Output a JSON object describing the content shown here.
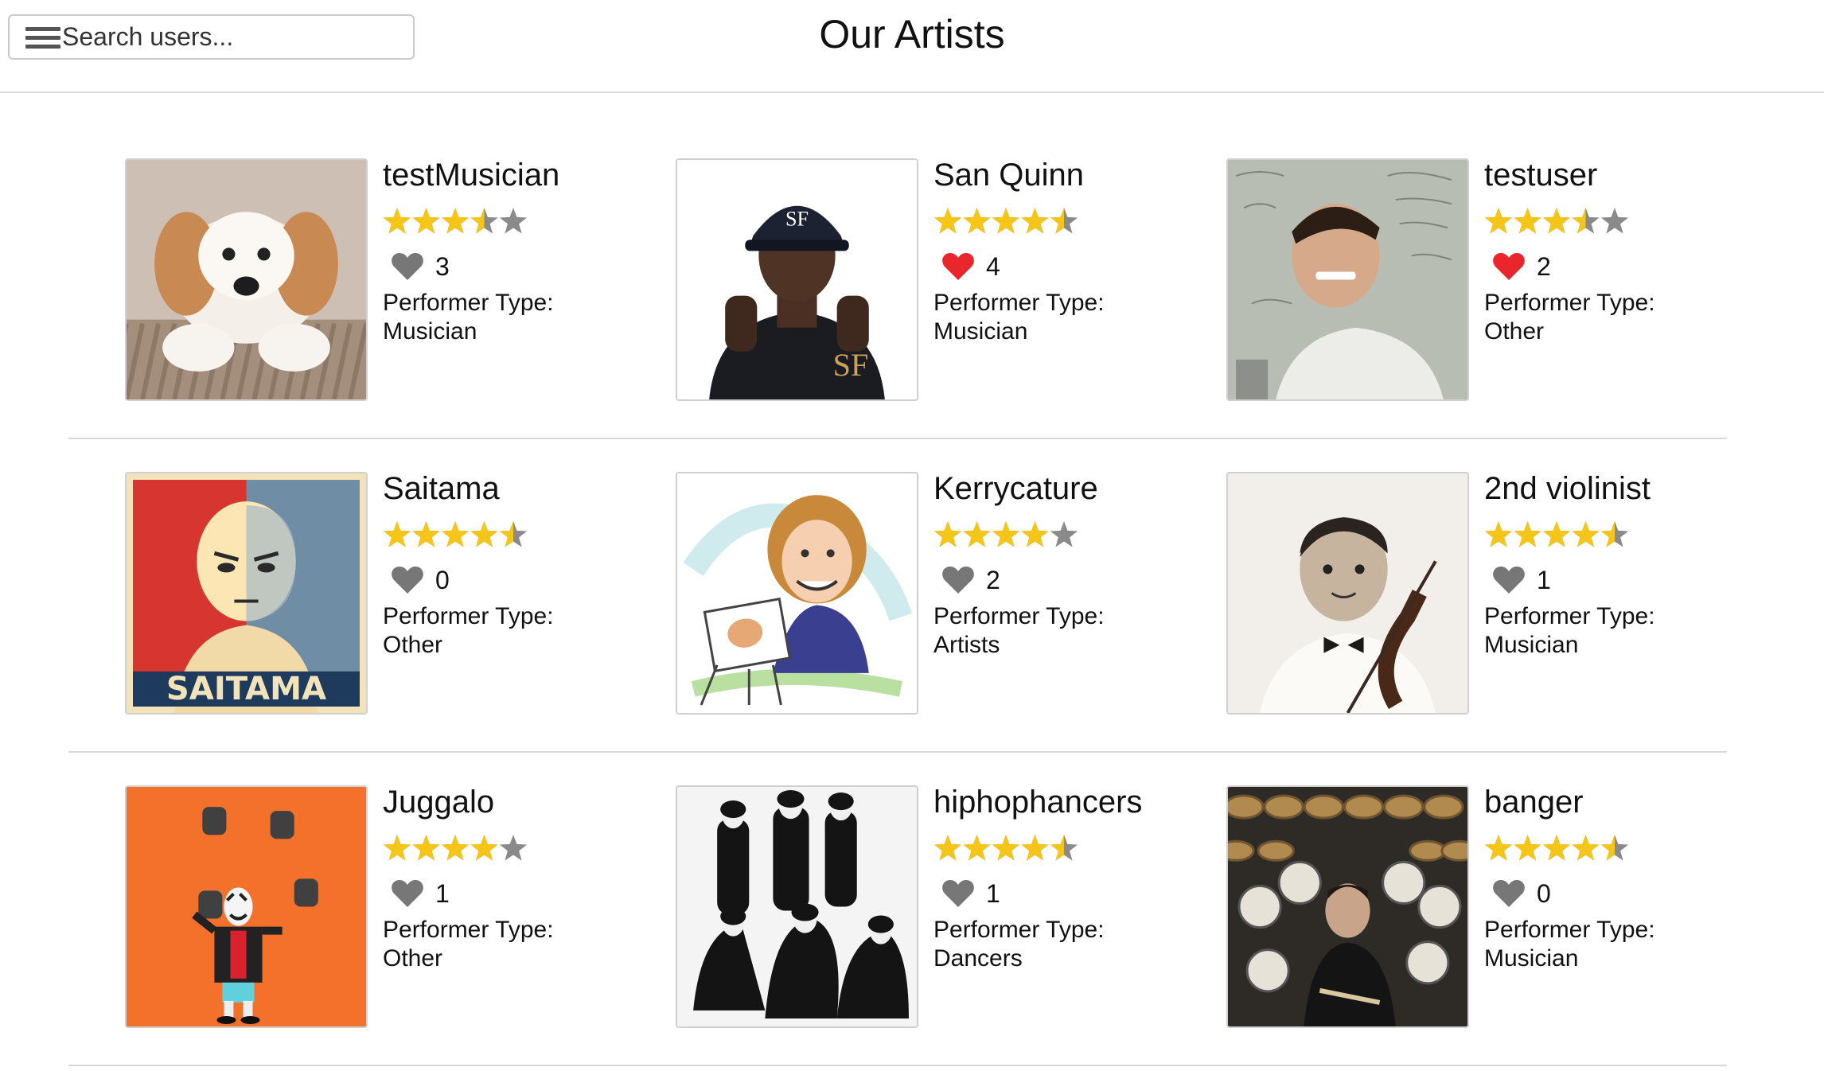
{
  "search": {
    "placeholder": "Search users..."
  },
  "page": {
    "title": "Our Artists"
  },
  "performer_type_label": "Performer Type:",
  "colors": {
    "star": "#f5c518",
    "star_empty": "#8a8a8a",
    "heart_liked": "#e8262b",
    "heart_default": "#777777"
  },
  "artists": [
    {
      "name": "testMusician",
      "rating": 3.5,
      "likes": "3",
      "liked": false,
      "performer_type": "Musician",
      "image": "puppy-photo"
    },
    {
      "name": "San Quinn",
      "rating": 4.5,
      "likes": "4",
      "liked": true,
      "performer_type": "Musician",
      "image": "rapper-photo"
    },
    {
      "name": "testuser",
      "rating": 3.5,
      "likes": "2",
      "liked": true,
      "performer_type": "Other",
      "image": "man-whiteboard-photo"
    },
    {
      "name": "Saitama",
      "rating": 4.5,
      "likes": "0",
      "liked": false,
      "performer_type": "Other",
      "image": "saitama-poster"
    },
    {
      "name": "Kerrycature",
      "rating": 4,
      "likes": "2",
      "liked": false,
      "performer_type": "Artists",
      "image": "caricature-drawing"
    },
    {
      "name": "2nd violinist",
      "rating": 4.5,
      "likes": "1",
      "liked": false,
      "performer_type": "Musician",
      "image": "child-violin-photo"
    },
    {
      "name": "Juggalo",
      "rating": 4,
      "likes": "1",
      "liked": false,
      "performer_type": "Other",
      "image": "juggalo-illustration"
    },
    {
      "name": "hiphophancers",
      "rating": 4.5,
      "likes": "1",
      "liked": false,
      "performer_type": "Dancers",
      "image": "dance-crew-photo"
    },
    {
      "name": "banger",
      "rating": 4.5,
      "likes": "0",
      "liked": false,
      "performer_type": "Musician",
      "image": "drummer-photo"
    }
  ]
}
